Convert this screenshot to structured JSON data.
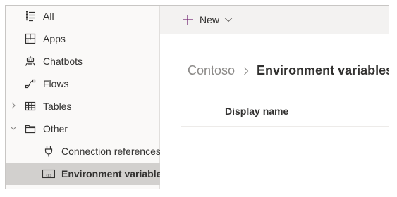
{
  "sidebar": {
    "items": [
      {
        "label": "All",
        "icon": "list-icon"
      },
      {
        "label": "Apps",
        "icon": "apps-icon"
      },
      {
        "label": "Chatbots",
        "icon": "chatbot-icon"
      },
      {
        "label": "Flows",
        "icon": "flow-icon"
      },
      {
        "label": "Tables",
        "icon": "table-icon",
        "expandable": true,
        "expanded": false
      },
      {
        "label": "Other",
        "icon": "folder-icon",
        "expandable": true,
        "expanded": true
      },
      {
        "label": "Connection references",
        "icon": "plug-icon"
      },
      {
        "label": "Environment variables",
        "icon": "variable-icon",
        "selected": true
      }
    ]
  },
  "commandbar": {
    "new_label": "New"
  },
  "breadcrumb": {
    "root": "Contoso",
    "current": "Environment variables"
  },
  "table": {
    "columns": [
      "Display name"
    ]
  },
  "colors": {
    "accent": "#742774",
    "selected_bg": "#d2d0ce",
    "sidebar_bg": "#faf9f8",
    "commandbar_bg": "#f3f2f1"
  }
}
